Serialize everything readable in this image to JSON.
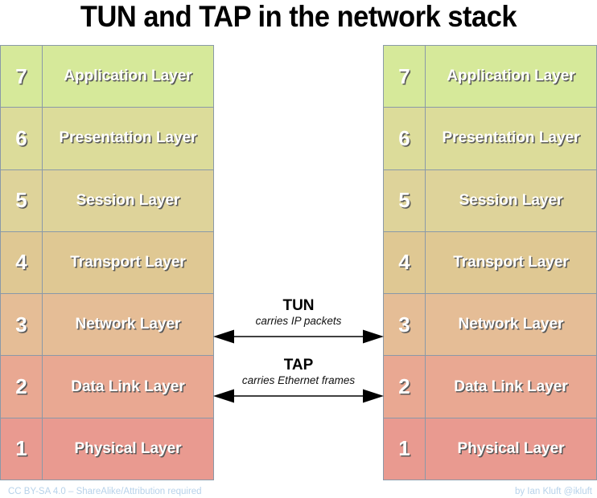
{
  "title": "TUN and TAP in the network stack",
  "colors": {
    "layer7": "#d6e99a",
    "layer6": "#dcdc9a",
    "layer5": "#ded39a",
    "layer4": "#dfc893",
    "layer3": "#e5bd96",
    "layer2": "#e9a892",
    "layer1": "#e99a90",
    "border": "#8a99a8",
    "text": "#ffffff",
    "text_shadow": "#5a5a5a",
    "footer": "#b7d2ea",
    "arrow": "#000000",
    "background": "#ffffff"
  },
  "stacks": {
    "left": {
      "label": "left-osi-stack",
      "layers": [
        {
          "number": "7",
          "name": "Application Layer"
        },
        {
          "number": "6",
          "name": "Presentation Layer"
        },
        {
          "number": "5",
          "name": "Session Layer"
        },
        {
          "number": "4",
          "name": "Transport Layer"
        },
        {
          "number": "3",
          "name": "Network Layer"
        },
        {
          "number": "2",
          "name": "Data Link Layer"
        },
        {
          "number": "1",
          "name": "Physical Layer"
        }
      ]
    },
    "right": {
      "label": "right-osi-stack",
      "layers": [
        {
          "number": "7",
          "name": "Application Layer"
        },
        {
          "number": "6",
          "name": "Presentation Layer"
        },
        {
          "number": "5",
          "name": "Session Layer"
        },
        {
          "number": "4",
          "name": "Transport Layer"
        },
        {
          "number": "3",
          "name": "Network Layer"
        },
        {
          "number": "2",
          "name": "Data Link Layer"
        },
        {
          "number": "1",
          "name": "Physical Layer"
        }
      ]
    }
  },
  "tunnels": [
    {
      "id": "tun",
      "title": "TUN",
      "subtitle": "carries IP packets",
      "connects_layer": "3",
      "arrow": "double-headed-horizontal"
    },
    {
      "id": "tap",
      "title": "TAP",
      "subtitle": "carries Ethernet frames",
      "connects_layer": "2",
      "arrow": "double-headed-horizontal"
    }
  ],
  "footer": {
    "license": "CC BY-SA 4.0 – ShareAlike/Attribution required",
    "author": "by Ian Kluft @ikluft"
  }
}
